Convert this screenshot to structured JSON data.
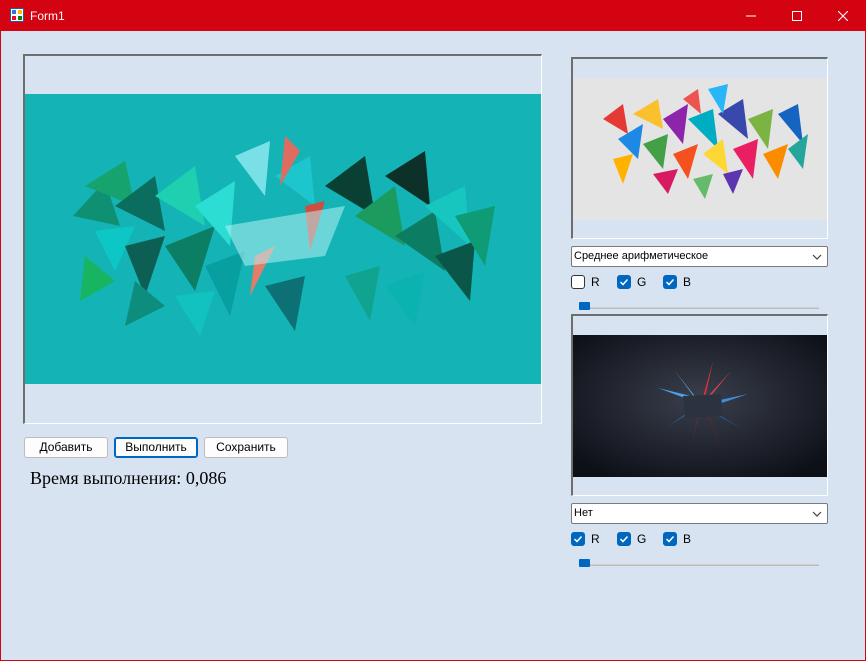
{
  "window": {
    "title": "Form1",
    "icon": "app-form-icon",
    "controls": [
      "minimize-icon",
      "maximize-icon",
      "close-icon"
    ],
    "accent": "#d30312",
    "background": "#d7e3f1"
  },
  "main_picture": {
    "content": "cyan abstract geometric triangles artwork"
  },
  "buttons": {
    "add": "Добавить",
    "execute": "Выполнить",
    "save": "Сохранить"
  },
  "timing": {
    "label": "Время выполнения:",
    "value": "0,086"
  },
  "panel_top": {
    "picture": "white colorful geometric triangles artwork",
    "combo_value": "Среднее арифметическое",
    "channels": [
      {
        "label": "R",
        "checked": false
      },
      {
        "label": "G",
        "checked": true
      },
      {
        "label": "B",
        "checked": true
      }
    ],
    "slider_value": 0
  },
  "panel_bottom": {
    "picture": "dark background with red and blue crystal star",
    "combo_value": "Нет",
    "channels": [
      {
        "label": "R",
        "checked": true
      },
      {
        "label": "G",
        "checked": true
      },
      {
        "label": "B",
        "checked": true
      }
    ],
    "slider_value": 0
  }
}
